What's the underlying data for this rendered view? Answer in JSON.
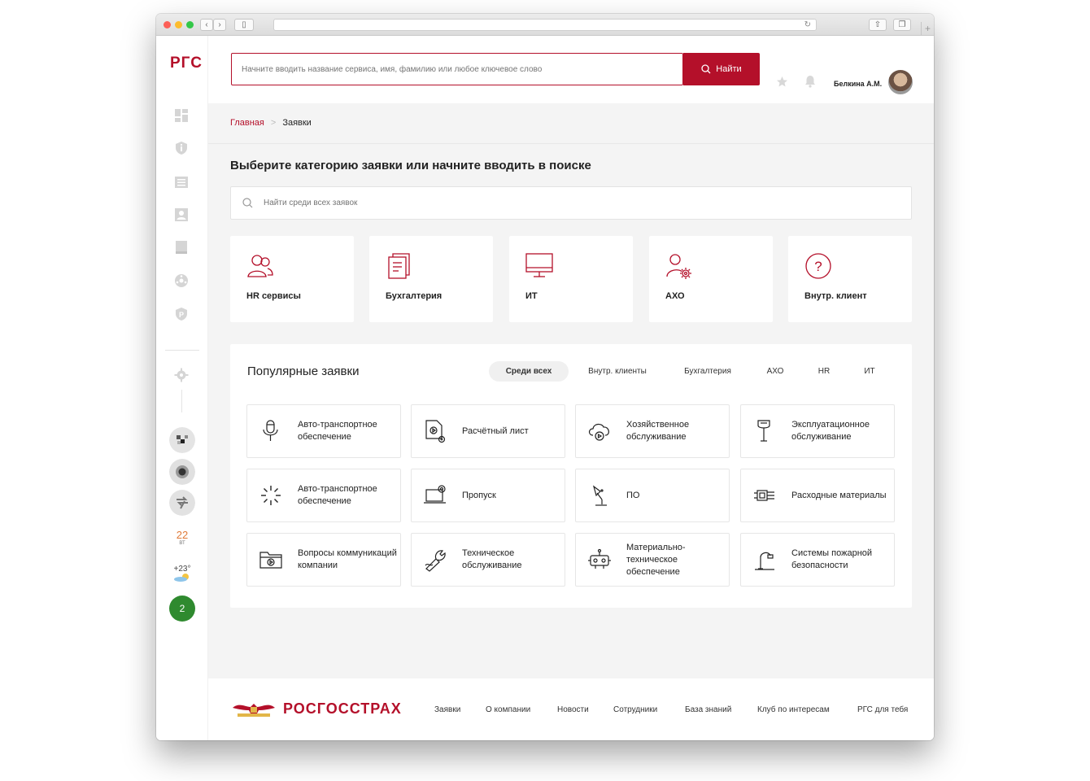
{
  "sidebar": {
    "logo": "РГС",
    "calendar": {
      "day_number": "22",
      "weekday": "ВТ"
    },
    "weather": {
      "temperature": "+23°"
    },
    "notification_count": "2"
  },
  "header": {
    "search_placeholder": "Начните вводить название сервиса, имя, фамилию или любое ключевое слово",
    "search_button": "Найти",
    "user_name": "Белкина А.М."
  },
  "breadcrumb": {
    "home": "Главная",
    "current": "Заявки"
  },
  "page": {
    "title": "Выберите категорию заявки или начните вводить в поиске",
    "request_search_placeholder": "Найти среди всех заявок"
  },
  "categories": [
    {
      "label": "HR сервисы",
      "icon": "people-icon"
    },
    {
      "label": "Бухгалтерия",
      "icon": "document-icon"
    },
    {
      "label": "ИТ",
      "icon": "monitor-icon"
    },
    {
      "label": "АХО",
      "icon": "user-gear-icon"
    },
    {
      "label": "Внутр. клиент",
      "icon": "question-icon"
    }
  ],
  "popular": {
    "title": "Популярные заявки",
    "filters": [
      {
        "label": "Среди всех",
        "active": true
      },
      {
        "label": "Внутр. клиенты",
        "active": false
      },
      {
        "label": "Бухгалтерия",
        "active": false
      },
      {
        "label": "АХО",
        "active": false
      },
      {
        "label": "HR",
        "active": false
      },
      {
        "label": "ИТ",
        "active": false
      }
    ],
    "items": [
      {
        "label": "Авто-транспортное обеспечение",
        "icon": "microphone-icon"
      },
      {
        "label": "Расчётный лист",
        "icon": "document-play-icon"
      },
      {
        "label": "Хозяйственное обслуживание",
        "icon": "cloud-play-icon"
      },
      {
        "label": "Эксплуатационное обслуживание",
        "icon": "lamp-icon"
      },
      {
        "label": "Авто-транспортное обеспечение",
        "icon": "loader-icon"
      },
      {
        "label": "Пропуск",
        "icon": "laptop-icon"
      },
      {
        "label": "ПО",
        "icon": "desk-lamp-icon"
      },
      {
        "label": "Расходные материалы",
        "icon": "chip-icon"
      },
      {
        "label": "Вопросы коммуникаций компании",
        "icon": "folder-play-icon"
      },
      {
        "label": "Техническое обслуживание",
        "icon": "wrench-pen-icon"
      },
      {
        "label": "Материально-техническое обеспечение",
        "icon": "robot-icon"
      },
      {
        "label": "Системы пожарной безопасности",
        "icon": "pipe-icon"
      }
    ]
  },
  "footer": {
    "brand": "РОСГОССТРАХ",
    "links": [
      "Заявки",
      "О компании",
      "Новости",
      "Сотрудники",
      "База знаний",
      "Клуб по интересам",
      "РГС для тебя"
    ]
  },
  "colors": {
    "accent": "#b4102a",
    "background": "#f4f4f4"
  }
}
